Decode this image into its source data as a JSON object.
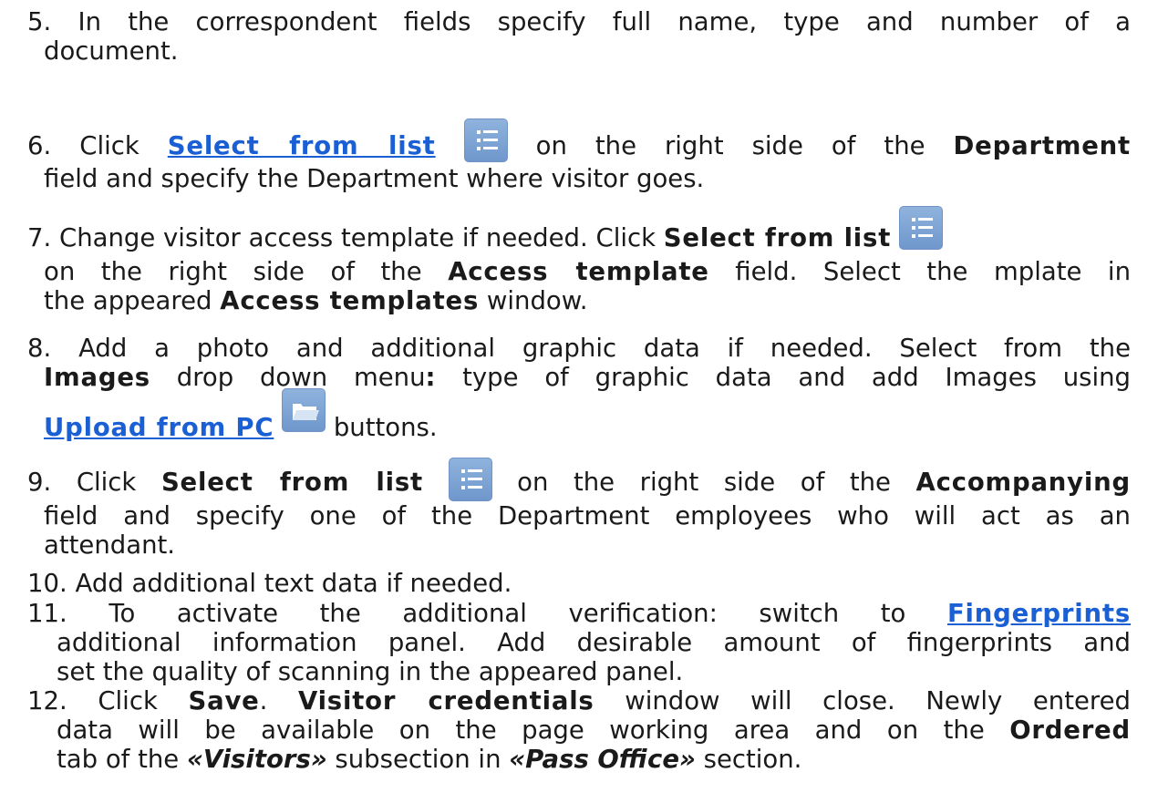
{
  "steps": {
    "s5": {
      "num": "5.",
      "line1": "In the correspondent fields specify full name, type and number of a",
      "line2": "document."
    },
    "s6": {
      "num": "6.",
      "pre": "Click ",
      "link": "Select from list",
      "mid": " on the right side of the ",
      "bold_field": "Department",
      "line2": "field and specify the Department where visitor goes."
    },
    "s7": {
      "num": "7.",
      "pre": "Change visitor access template if needed. Click ",
      "bold_sel": "Select from list",
      "l2_pre": "on the right side of the ",
      "bold_field": "Access template",
      "l2_post": " field. Select the mplate in",
      "l3_pre": "the appeared ",
      "bold_window": "Access templates",
      "l3_post": " window."
    },
    "s8": {
      "num": "8.",
      "line1": "Add a photo and additional graphic data if needed. Select from the",
      "bold_menu": "Images",
      "l2_mid": " drop down menu",
      "colon": ":",
      "l2_post": " type of graphic data and add Images using",
      "link": "Upload from PC",
      "post": "buttons."
    },
    "s9": {
      "num": "9.",
      "pre": "Click ",
      "bold_sel": "Select from list",
      "mid": " on the right side of the ",
      "bold_field": "Accompanying",
      "line2": "field and specify one of the Department employees who will act as an",
      "line3": "attendant."
    },
    "s10": {
      "num": "10.",
      "text": "Add additional text data if needed."
    },
    "s11": {
      "num": "11.",
      "pre": "To activate the additional verification: switch to ",
      "link": "Fingerprints",
      "line2": "additional information panel. Add desirable amount of fingerprints and",
      "line3": "set the quality of scanning in the appeared panel."
    },
    "s12": {
      "num": "12.",
      "pre": "Click ",
      "bold_save": "Save",
      "dot": ". ",
      "bold_window": "Visitor credentials",
      "post": " window will close. Newly entered",
      "line2": "data will be available on the page working area and on the ",
      "bold_tab": "Ordered",
      "l3_pre": "tab of the ",
      "visitors": "«Visitors»",
      "l3_mid": " subsection in ",
      "pass_office": "«Pass Office»",
      "l3_post": " section."
    }
  },
  "icons": {
    "list": "list-icon",
    "folder": "folder-icon"
  },
  "colors": {
    "link": "#1a5fd4",
    "button": "#7fa5d6"
  }
}
